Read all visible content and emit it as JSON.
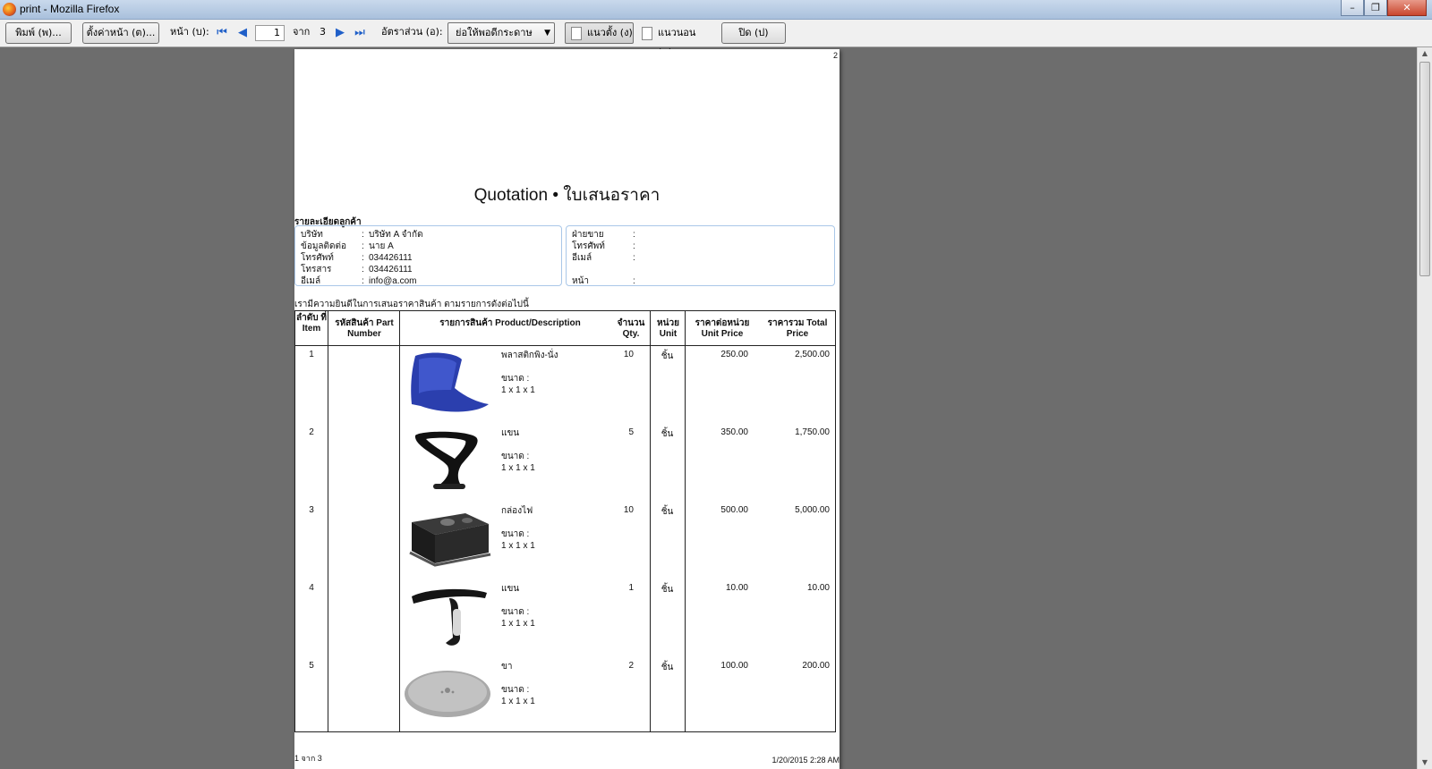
{
  "window": {
    "title": "print - Mozilla Firefox"
  },
  "toolbar": {
    "print_label": "พิมพ์ (พ)...",
    "page_setup_label": "ตั้งค่าหน้า (ต)...",
    "page_label": "หน้า (บ):",
    "page_value": "1",
    "of_label": "จาก",
    "total_pages": "3",
    "scale_label": "อัตราส่วน (อ):",
    "scale_value": "ย่อให้พอดีกระดาษ",
    "portrait_label": "แนวตั้ง (ง)",
    "landscape_label": "แนวนอน (น)",
    "close_label": "ปิด (ป)"
  },
  "document": {
    "page_corner": "2",
    "title": "Quotation • ใบเสนอราคา",
    "customer_section": "รายละเอียดลูกค้า",
    "customer": [
      {
        "key": "บริษัท",
        "value": "บริษัท A จำกัด"
      },
      {
        "key": "ข้อมูลติดต่อ",
        "value": "นาย A"
      },
      {
        "key": "โทรศัพท์",
        "value": "034426111"
      },
      {
        "key": "โทรสาร",
        "value": "034426111"
      },
      {
        "key": "อีเมล์",
        "value": "info@a.com"
      }
    ],
    "seller": [
      {
        "key": "ฝ่ายขาย",
        "value": ""
      },
      {
        "key": "โทรศัพท์",
        "value": ""
      },
      {
        "key": "อีเมล์",
        "value": ""
      },
      {
        "key": "หน้า",
        "value": ""
      }
    ],
    "intro": "เรามีความยินดีในการเสนอราคาสินค้า ตามรายการดังต่อไปนี้",
    "columns": {
      "item": "ลำดับ ที่ Item",
      "part": "รหัสสินค้า Part Number",
      "desc": "รายการสินค้า Product/Description",
      "qty": "จำนวน Qty.",
      "unit": "หน่วย Unit",
      "unit_price": "ราคาต่อหน่วย Unit Price",
      "total": "ราคารวม Total Price"
    },
    "items": [
      {
        "no": "1",
        "name": "พลาสติกพิง-นั่ง",
        "size_label": "ขนาด :",
        "size": "1 x 1 x 1",
        "qty": "10",
        "unit": "ชิ้น",
        "unit_price": "250.00",
        "total": "2,500.00",
        "image": "blue-seat-shell"
      },
      {
        "no": "2",
        "name": "แขน",
        "size_label": "ขนาด :",
        "size": "1 x 1 x 1",
        "qty": "5",
        "unit": "ชิ้น",
        "unit_price": "350.00",
        "total": "1,750.00",
        "image": "black-loop-armrest"
      },
      {
        "no": "3",
        "name": "กล่องไฟ",
        "size_label": "ขนาด :",
        "size": "1 x 1 x 1",
        "qty": "10",
        "unit": "ชิ้น",
        "unit_price": "500.00",
        "total": "5,000.00",
        "image": "power-box"
      },
      {
        "no": "4",
        "name": "แขน",
        "size_label": "ขนาด :",
        "size": "1 x 1 x 1",
        "qty": "1",
        "unit": "ชิ้น",
        "unit_price": "10.00",
        "total": "10.00",
        "image": "t-armrest"
      },
      {
        "no": "5",
        "name": "ขา",
        "size_label": "ขนาด :",
        "size": "1 x 1 x 1",
        "qty": "2",
        "unit": "ชิ้น",
        "unit_price": "100.00",
        "total": "200.00",
        "image": "round-base"
      }
    ],
    "footer_left": "1 จาก 3",
    "footer_right": "1/20/2015 2:28 AM"
  }
}
